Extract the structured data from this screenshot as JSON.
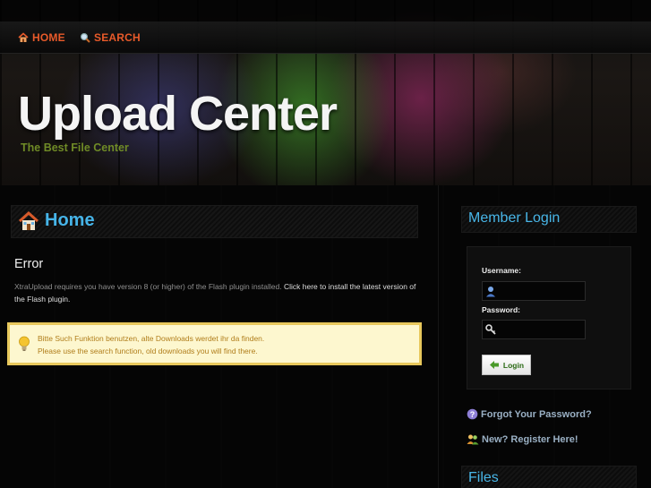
{
  "nav": {
    "home_label": "HOME",
    "search_label": "SEARCH",
    "home_icon": "house-icon",
    "search_icon": "magnifier-icon",
    "accent_color": "#e85a2a"
  },
  "site": {
    "title": "Upload Center",
    "tagline": "The Best File Center"
  },
  "main": {
    "heading": "Home",
    "heading_icon": "house-icon",
    "error_title": "Error",
    "error_text": "XtraUpload requires you have version 8 (or higher) of the Flash plugin installed.",
    "error_link": "Click here to install the latest version of the Flash plugin.",
    "notice_line1": "Bitte Such Funktion benutzen, alte Downloads werdet ihr da finden.",
    "notice_line2": "Please use the search function, old downloads you will find there.",
    "notice_icon": "lightbulb-icon"
  },
  "sidebar": {
    "member_title": "Member Login",
    "username_label": "Username:",
    "password_label": "Password:",
    "username_value": "",
    "password_value": "",
    "login_label": "Login",
    "forgot_label": "Forgot Your Password?",
    "register_label": "New? Register Here!",
    "files_title": "Files",
    "heading_color": "#48b6e8"
  }
}
